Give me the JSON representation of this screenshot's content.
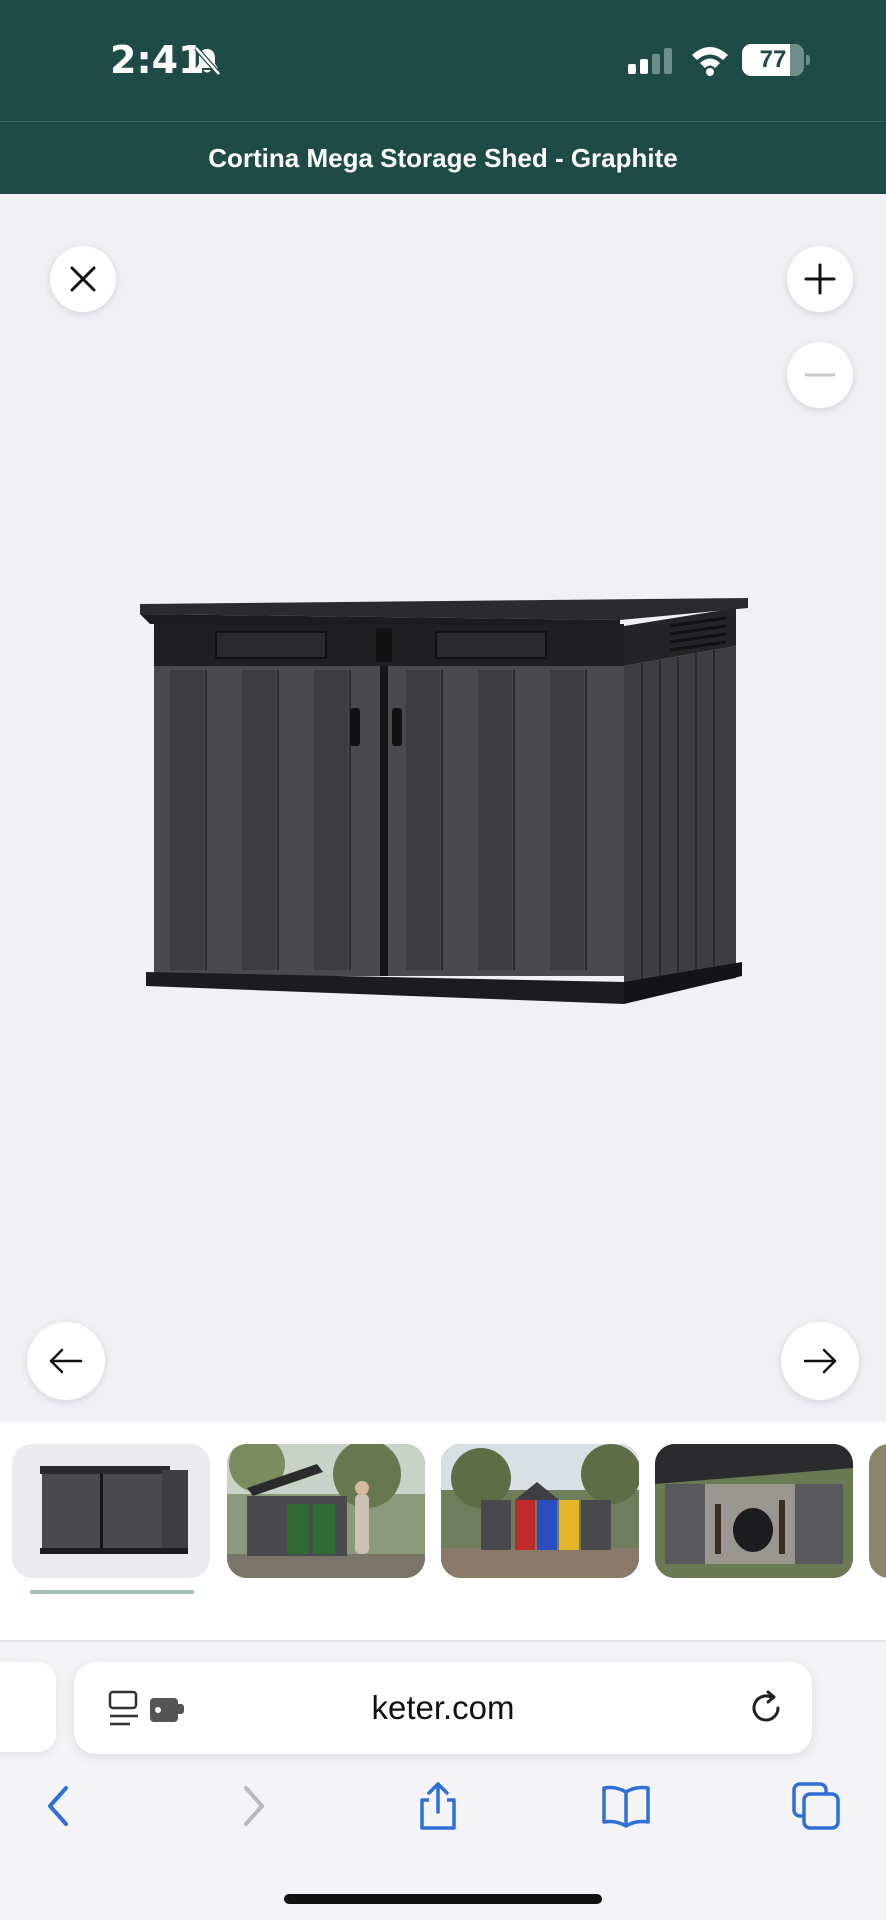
{
  "status_bar": {
    "time": "2:41",
    "battery_level": "77",
    "battery_fraction": 0.77,
    "icons": [
      "bell-slash-icon",
      "cellular-signal-icon",
      "wifi-icon",
      "battery-icon"
    ]
  },
  "header": {
    "title": "Cortina Mega Storage Shed - Graphite",
    "background_color": "#1e4a47"
  },
  "viewer": {
    "controls": [
      "close-icon",
      "zoom-in-icon",
      "zoom-out-icon",
      "arrow-left-icon",
      "arrow-right-icon"
    ],
    "image_alt": "Storage shed product image"
  },
  "thumbnails": {
    "items": [
      "shed-front-view",
      "shed-with-bins-open",
      "shed-with-colored-bins",
      "shed-open-with-tools"
    ],
    "selected_index": 0
  },
  "browser": {
    "url": "keter.com",
    "accent_color": "#2f6fd6",
    "toolbar_icons": [
      "back-icon",
      "forward-icon",
      "share-icon",
      "bookmarks-icon",
      "tabs-icon"
    ]
  }
}
